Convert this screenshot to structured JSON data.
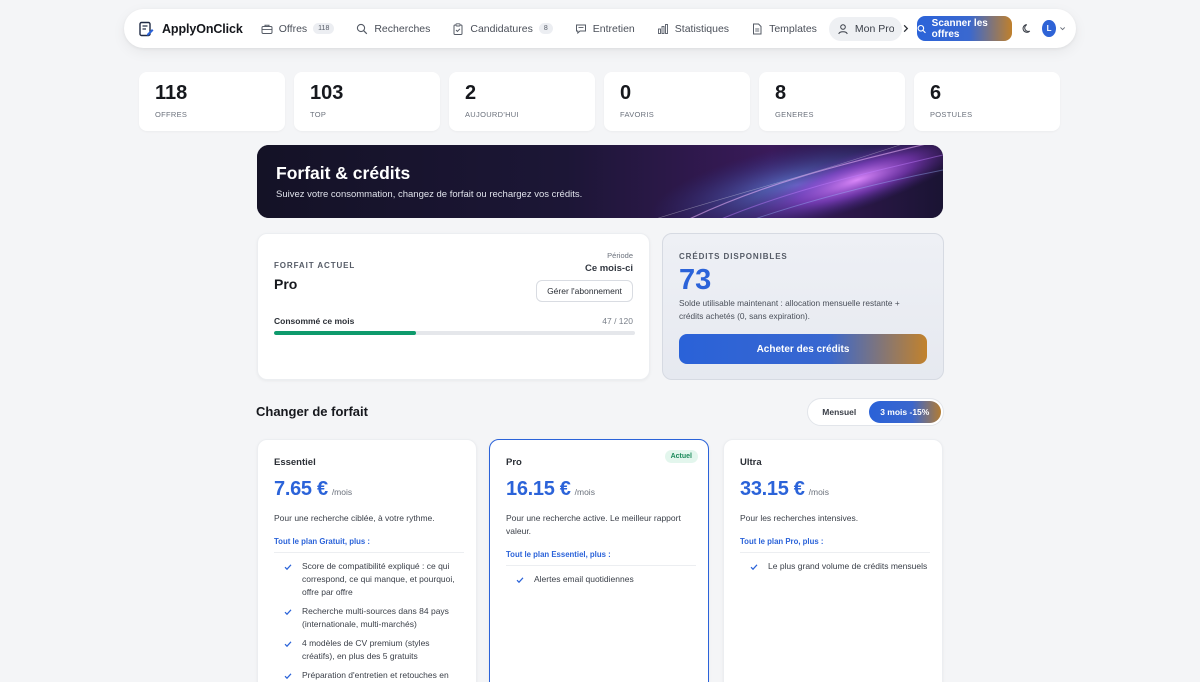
{
  "brand": {
    "name": "ApplyOnClick",
    "logo_icon": "document-pen-icon"
  },
  "nav": {
    "items": [
      {
        "label": "Offres",
        "icon": "briefcase-icon",
        "badge": "118"
      },
      {
        "label": "Recherches",
        "icon": "search-icon"
      },
      {
        "label": "Candidatures",
        "icon": "clipboard-icon",
        "badge": "8"
      },
      {
        "label": "Entretien",
        "icon": "chat-icon"
      },
      {
        "label": "Statistiques",
        "icon": "bar-chart-icon"
      },
      {
        "label": "Templates",
        "icon": "file-icon"
      }
    ],
    "profile_label": "Mon Profil",
    "scan_label": "Scanner les offres",
    "avatar_initial": "L"
  },
  "stats": [
    {
      "value": "118",
      "label": "OFFRES"
    },
    {
      "value": "103",
      "label": "TOP"
    },
    {
      "value": "2",
      "label": "AUJOURD'HUI"
    },
    {
      "value": "0",
      "label": "FAVORIS"
    },
    {
      "value": "8",
      "label": "GENERES"
    },
    {
      "value": "6",
      "label": "POSTULES"
    }
  ],
  "hero": {
    "title": "Forfait & crédits",
    "subtitle": "Suivez votre consommation, changez de forfait ou rechargez vos crédits."
  },
  "current_plan": {
    "kicker": "FORFAIT ACTUEL",
    "name": "Pro",
    "period_label": "Période",
    "period_value": "Ce mois-ci",
    "manage_label": "Gérer l'abonnement",
    "consumed_label": "Consommé ce mois",
    "consumed_value": "47 / 120",
    "consumed_fraction": 0.392
  },
  "credits": {
    "kicker": "CRÉDITS DISPONIBLES",
    "value": "73",
    "description": "Solde utilisable maintenant : allocation mensuelle restante + crédits achetés (0, sans expiration).",
    "buy_label": "Acheter des crédits"
  },
  "change_plan": {
    "title": "Changer de forfait",
    "billing": {
      "monthly": "Mensuel",
      "quarterly": "3 mois -15%",
      "selected": "quarterly"
    }
  },
  "tiers": [
    {
      "name": "Essentiel",
      "price": "7.65 €",
      "unit": "/mois",
      "description": "Pour une recherche ciblée, à votre rythme.",
      "includes": "Tout le plan Gratuit, plus :",
      "features": [
        "Score de compatibilité expliqué : ce qui correspond, ce qui manque, et pourquoi, offre par offre",
        "Recherche multi-sources dans 84 pays (internationale, multi-marchés)",
        "4 modèles de CV premium (styles créatifs), en plus des 5 gratuits",
        "Préparation d'entretien et retouches en"
      ]
    },
    {
      "name": "Pro",
      "badge": "Actuel",
      "price": "16.15 €",
      "unit": "/mois",
      "description": "Pour une recherche active. Le meilleur rapport valeur.",
      "includes": "Tout le plan Essentiel, plus :",
      "features": [
        "Alertes email quotidiennes"
      ]
    },
    {
      "name": "Ultra",
      "price": "33.15 €",
      "unit": "/mois",
      "description": "Pour les recherches intensives.",
      "includes": "Tout le plan Pro, plus :",
      "features": [
        "Le plus grand volume de crédits mensuels"
      ]
    }
  ],
  "colors": {
    "accent_blue": "#2b63d9",
    "accent_gold": "#c0802b",
    "progress_green": "#0e9a6c"
  }
}
